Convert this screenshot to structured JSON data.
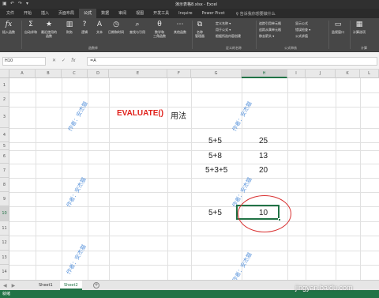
{
  "window": {
    "title": "演示表格8.xlsx - Excel",
    "qat_icons": [
      "save-icon",
      "undo-icon",
      "redo-icon",
      "customize-icon"
    ]
  },
  "ribbon_tabs": [
    "文件",
    "开始",
    "插入",
    "页面布局",
    "公式",
    "数据",
    "审阅",
    "视图",
    "开发工具",
    "Inquire",
    "Power Pivot"
  ],
  "active_tab": "公式",
  "tell_me": "♀ 告诉我你想要做什么",
  "ribbon": {
    "insert_function": "插入函数",
    "autosum": "自动求和",
    "recent": "最近使用的\n函数",
    "financial": "财务",
    "logical": "逻辑",
    "text": "文本",
    "datetime": "日期和时间",
    "lookup": "查找与引用",
    "math": "数学和\n三角函数",
    "other": "其他函数",
    "group_library": "函数库",
    "name_manager": "名称\n管理器",
    "define_name": "定义名称 ▾",
    "use_in_formula": "用于公式 ▾",
    "create_from_selection": "根据所选内容创建",
    "group_names": "定义的名称",
    "trace_precedents": "追踪引用单元格",
    "trace_dependents": "追踪从属单元格",
    "remove_arrows": "移去箭头 ▾",
    "show_formulas": "显示公式",
    "error_checking": "错误检查 ▾",
    "evaluate_formula": "公式求值",
    "group_audit": "公式审核",
    "watch_window": "监视窗口",
    "calc_options": "计算选项",
    "group_calc": "计算"
  },
  "formula_bar": {
    "name_box": "H10",
    "formula": "=A"
  },
  "columns": [
    "A",
    "B",
    "C",
    "D",
    "E",
    "F",
    "G",
    "H",
    "I",
    "J",
    "K",
    "L"
  ],
  "selected_column": "H",
  "rows": [
    "1",
    "2",
    "3",
    "4",
    "5",
    "6",
    "7",
    "8",
    "9",
    "10",
    "11",
    "12",
    "13",
    "14"
  ],
  "selected_row": "10",
  "cells": {
    "e3": "EVALUATE()",
    "f3": "用法",
    "g5": "5+5",
    "h5": "25",
    "g6": "5+8",
    "h6": "13",
    "g7": "5+3+5",
    "h7": "20",
    "g10": "5+5",
    "h10": "10"
  },
  "watermark": "作者：安杰猫",
  "sheets": [
    "Sheet1",
    "Sheet2"
  ],
  "active_sheet": "Sheet2",
  "status": "就绪",
  "site_watermark": "jingyan.baidu.com",
  "colors": {
    "accent": "#217346",
    "title_red": "#e0211b",
    "ribbon_bg": "#474747",
    "annotation_red": "#d93030",
    "watermark_blue": "#4a8ad8"
  }
}
